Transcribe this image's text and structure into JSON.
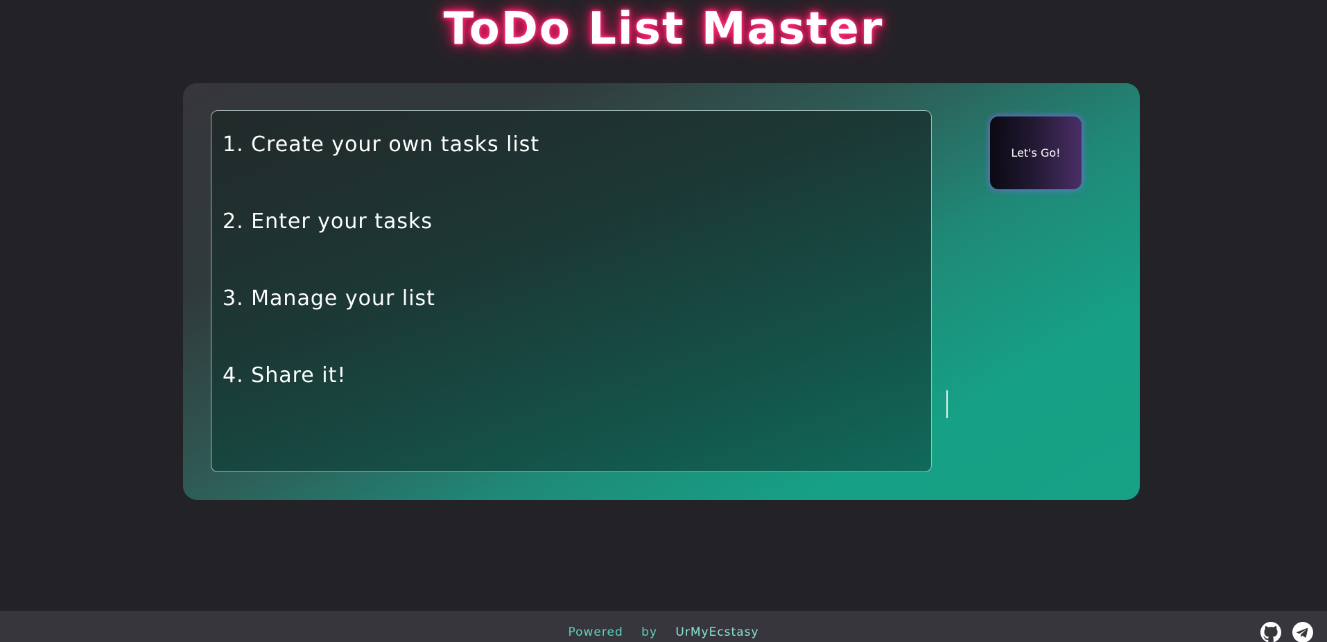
{
  "header": {
    "title": "ToDo List Master"
  },
  "steps": [
    "1. Create your own tasks list",
    "2. Enter your tasks",
    "3. Manage your list",
    "4. Share it!"
  ],
  "actions": {
    "start_label": "Let's Go!"
  },
  "footer": {
    "powered": "Powered",
    "by": "by",
    "author": "UrMyEcstasy",
    "icons": [
      "github-icon",
      "telegram-icon"
    ]
  },
  "colors": {
    "background": "#232327",
    "title_glow": "#ff2d7a",
    "accent": "#16a085",
    "footer_bg": "#36363c",
    "footer_text": "#5fd1bd"
  }
}
